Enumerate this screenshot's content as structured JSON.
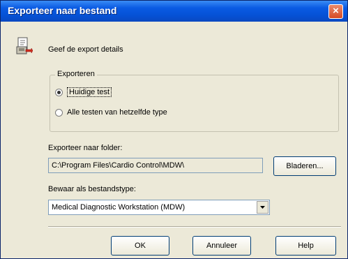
{
  "window": {
    "title": "Exporteer naar bestand",
    "close_glyph": "×"
  },
  "header": {
    "icon": "export-document-icon",
    "text": "Geef de export details"
  },
  "export_group": {
    "legend": "Exporteren",
    "options": [
      {
        "label": "Huidige test",
        "checked": true
      },
      {
        "label": "Alle testen van hetzelfde type",
        "checked": false
      }
    ]
  },
  "folder": {
    "label": "Exporteer naar folder:",
    "value": "C:\\Program Files\\Cardio Control\\MDW\\",
    "browse_label": "Bladeren..."
  },
  "filetype": {
    "label": "Bewaar als bestandstype:",
    "selected": "Medical Diagnostic Workstation (MDW)"
  },
  "buttons": {
    "ok": "OK",
    "cancel": "Annuleer",
    "help": "Help"
  },
  "colors": {
    "titlebar": "#0a5ae3",
    "dialog_bg": "#ece9d8",
    "close": "#d64a24"
  }
}
